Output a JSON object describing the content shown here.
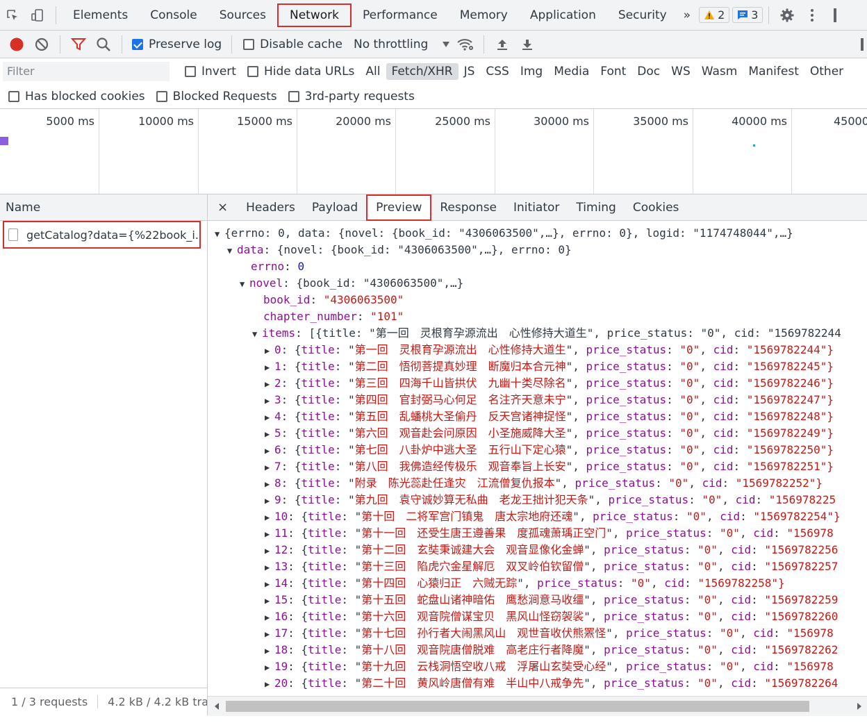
{
  "toolbar": {
    "tabs": [
      "Elements",
      "Console",
      "Sources",
      "Network",
      "Performance",
      "Memory",
      "Application",
      "Security"
    ],
    "selected_tab": "Network",
    "more": "»",
    "warnings": "2",
    "messages": "3"
  },
  "network_bar": {
    "preserve_log": "Preserve log",
    "disable_cache": "Disable cache",
    "throttling": "No throttling"
  },
  "filter": {
    "placeholder": "Filter",
    "invert": "Invert",
    "hide_data_urls": "Hide data URLs",
    "types": [
      "All",
      "Fetch/XHR",
      "JS",
      "CSS",
      "Img",
      "Media",
      "Font",
      "Doc",
      "WS",
      "Wasm",
      "Manifest",
      "Other"
    ],
    "selected_type": "Fetch/XHR",
    "has_blocked_cookies": "Has blocked cookies",
    "blocked_requests": "Blocked Requests",
    "third_party": "3rd-party requests"
  },
  "timeline": {
    "labels": [
      "5000 ms",
      "10000 ms",
      "15000 ms",
      "20000 ms",
      "25000 ms",
      "30000 ms",
      "35000 ms",
      "40000 ms",
      "45000"
    ]
  },
  "requests": {
    "header": "Name",
    "selected": "getCatalog?data={%22book_i...",
    "footer_count": "1 / 3 requests",
    "footer_size": "4.2 kB / 4.2 kB tra"
  },
  "details": {
    "close": "×",
    "tabs": [
      "Headers",
      "Payload",
      "Preview",
      "Response",
      "Initiator",
      "Timing",
      "Cookies"
    ],
    "selected_tab": "Preview"
  },
  "preview": {
    "root": "{errno: 0, data: {novel: {book_id: \"4306063500\",…}, errno: 0}, logid: \"1174748044\",…}",
    "data_summary": "{novel: {book_id: \"4306063500\",…}, errno: 0}",
    "errno": "0",
    "novel_summary": "{book_id: \"4306063500\",…}",
    "book_id": "\"4306063500\"",
    "chapter_number": "\"101\"",
    "items_summary": "[{title: \"第一回　灵根育孕源流出　心性修持大道生\", price_status: \"0\", cid: \"1569782244",
    "items": [
      {
        "i": "0",
        "title": "第一回　灵根育孕源流出　心性修持大道生",
        "cid": "\"1569782244\"}"
      },
      {
        "i": "1",
        "title": "第二回　悟彻菩提真妙理　断魔归本合元神",
        "cid": "\"1569782245\"}"
      },
      {
        "i": "2",
        "title": "第三回　四海千山皆拱伏　九幽十类尽除名",
        "cid": "\"1569782246\"}"
      },
      {
        "i": "3",
        "title": "第四回　官封弼马心何足　名注齐天意未宁",
        "cid": "\"1569782247\"}"
      },
      {
        "i": "4",
        "title": "第五回　乱蟠桃大圣偷丹　反天宫诸神捉怪",
        "cid": "\"1569782248\"}"
      },
      {
        "i": "5",
        "title": "第六回　观音赴会问原因　小圣施威降大圣",
        "cid": "\"1569782249\"}"
      },
      {
        "i": "6",
        "title": "第七回　八卦炉中逃大圣　五行山下定心猿",
        "cid": "\"1569782250\"}"
      },
      {
        "i": "7",
        "title": "第八回　我佛造经传极乐　观音奉旨上长安",
        "cid": "\"1569782251\"}"
      },
      {
        "i": "8",
        "title": "附录　陈光蕊赴任逢灾　江流僧复仇报本",
        "cid": "\"1569782252\"}"
      },
      {
        "i": "9",
        "title": "第九回　袁守诚妙算无私曲　老龙王拙计犯天条",
        "cid": "\"156978225"
      },
      {
        "i": "10",
        "title": "第十回　二将军宫门镇鬼　唐太宗地府还魂",
        "cid": "\"1569782254\"}"
      },
      {
        "i": "11",
        "title": "第十一回　还受生唐王遵善果　度孤魂萧瑀正空门",
        "cid": "\"156978"
      },
      {
        "i": "12",
        "title": "第十二回　玄奘秉诚建大会　观音显像化金蝉",
        "cid": "\"1569782256"
      },
      {
        "i": "13",
        "title": "第十三回　陷虎穴金星解厄　双叉岭伯钦留僧",
        "cid": "\"1569782257"
      },
      {
        "i": "14",
        "title": "第十四回　心猿归正　六贼无踪",
        "cid": "\"1569782258\"}"
      },
      {
        "i": "15",
        "title": "第十五回　蛇盘山诸神暗佑　鹰愁涧意马收缰",
        "cid": "\"1569782259"
      },
      {
        "i": "16",
        "title": "第十六回　观音院僧谋宝贝　黑风山怪窃袈裟",
        "cid": "\"1569782260"
      },
      {
        "i": "17",
        "title": "第十七回　孙行者大闹黑风山　观世音收伏熊罴怪",
        "cid": "\"156978"
      },
      {
        "i": "18",
        "title": "第十八回　观音院唐僧脱难　高老庄行者降魔",
        "cid": "\"1569782262"
      },
      {
        "i": "19",
        "title": "第十九回　云栈洞悟空收八戒　浮屠山玄奘受心经",
        "cid": "\"156978"
      },
      {
        "i": "20",
        "title": "第二十回　黄风岭唐僧有难　半山中八戒争先",
        "cid": "\"1569782264"
      }
    ],
    "price_status_value": "\"0\""
  }
}
